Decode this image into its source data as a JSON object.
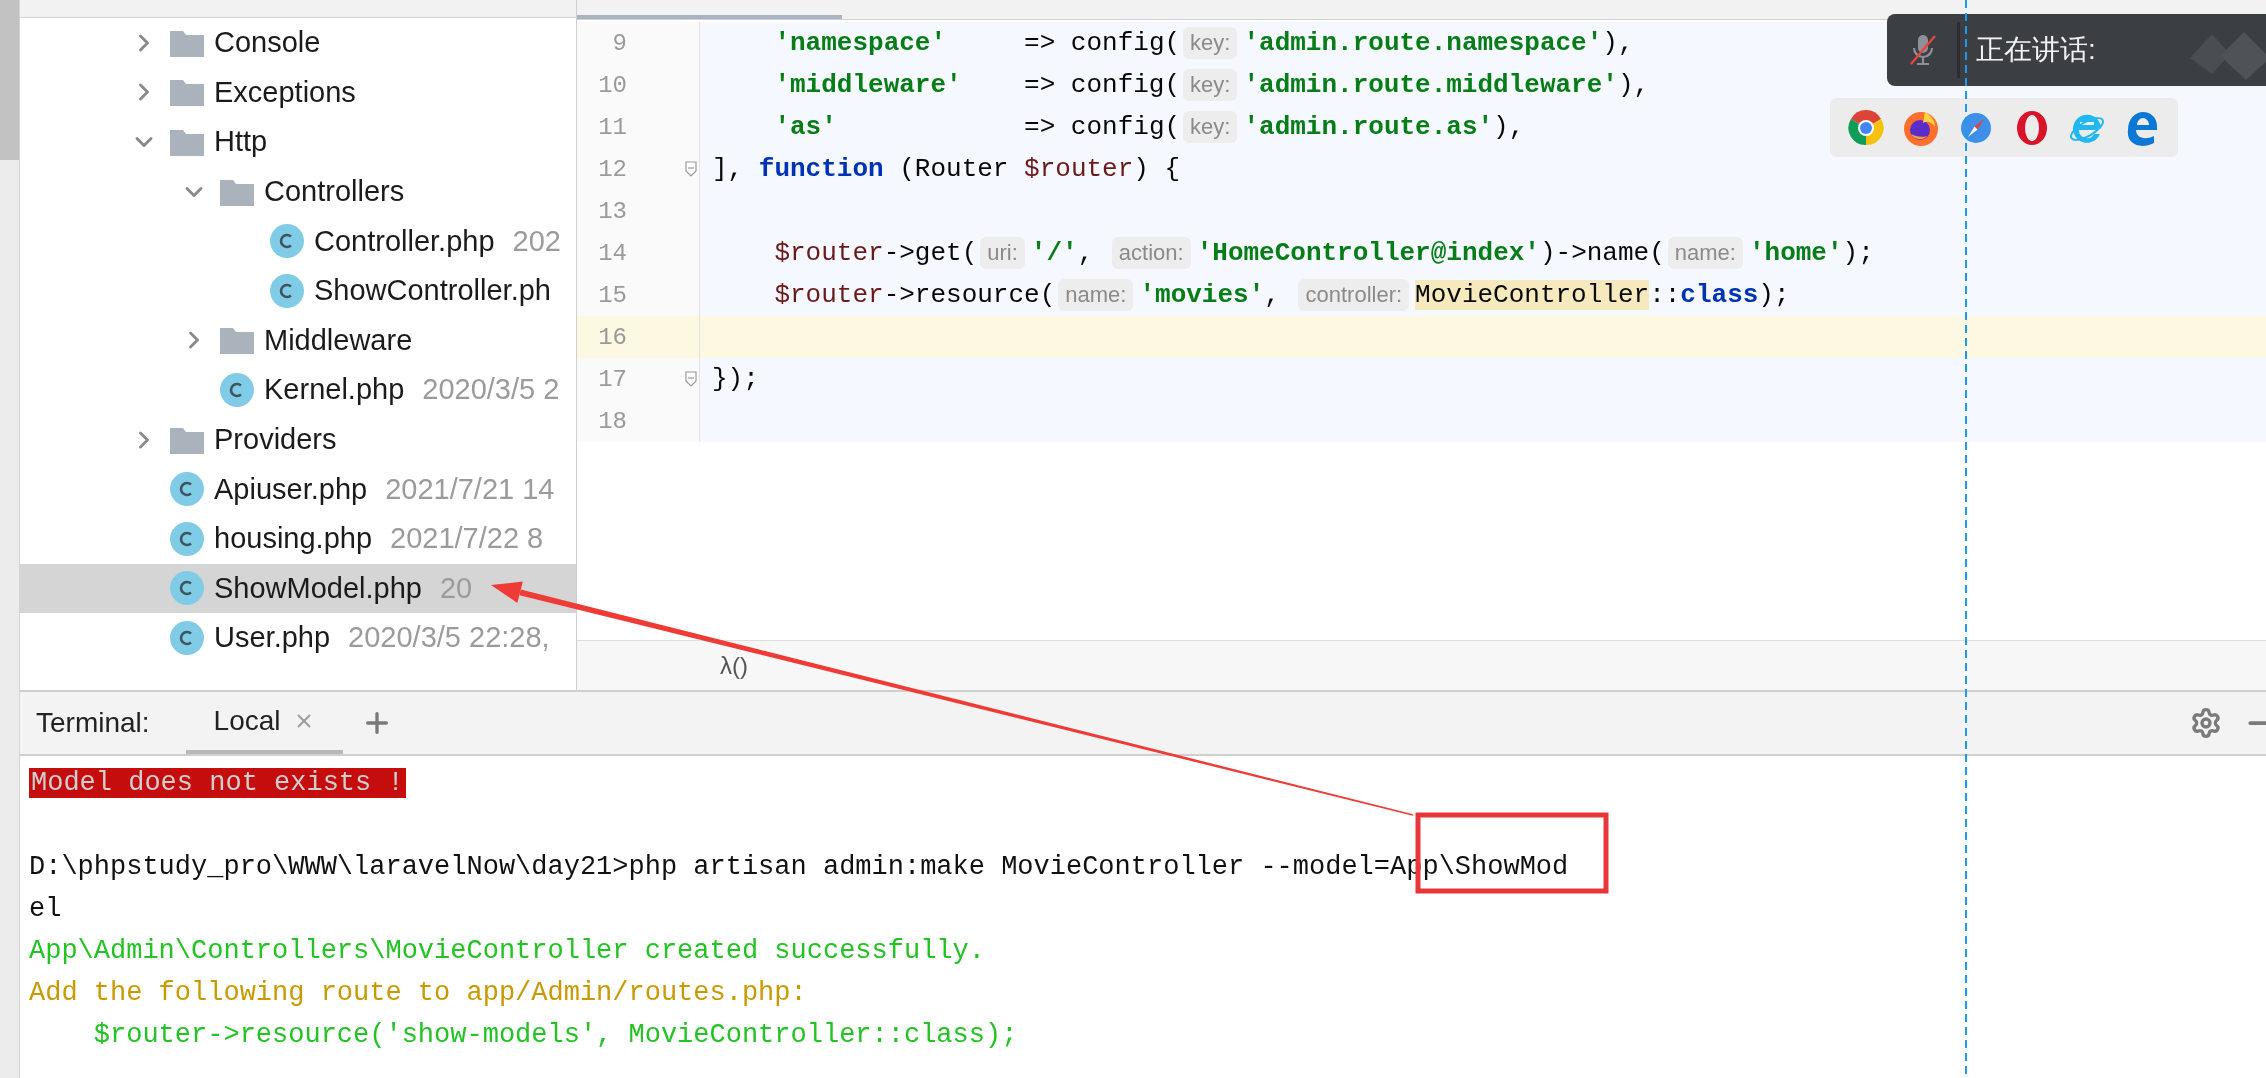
{
  "project_tree": {
    "items": [
      {
        "name": "Console",
        "kind": "folder",
        "expanded": false,
        "selected": false
      },
      {
        "name": "Exceptions",
        "kind": "folder",
        "expanded": false,
        "selected": false
      },
      {
        "name": "Http",
        "kind": "folder",
        "expanded": true,
        "selected": false,
        "children": [
          {
            "name": "Controllers",
            "kind": "folder",
            "expanded": true,
            "selected": false,
            "children": [
              {
                "name": "Controller.php",
                "kind": "class",
                "meta": "202",
                "selected": false
              },
              {
                "name": "ShowController.ph",
                "kind": "class",
                "selected": false
              }
            ]
          },
          {
            "name": "Middleware",
            "kind": "folder",
            "expanded": false,
            "selected": false
          },
          {
            "name": "Kernel.php",
            "kind": "class",
            "meta": "2020/3/5 2",
            "selected": false
          }
        ]
      },
      {
        "name": "Providers",
        "kind": "folder",
        "expanded": false,
        "selected": false
      },
      {
        "name": "Apiuser.php",
        "kind": "class",
        "meta": "2021/7/21 14",
        "selected": false
      },
      {
        "name": "housing.php",
        "kind": "class",
        "meta": "2021/7/22 8",
        "selected": false
      },
      {
        "name": "ShowModel.php",
        "kind": "class",
        "meta": "20",
        "selected": true
      },
      {
        "name": "User.php",
        "kind": "class",
        "meta": "2020/3/5 22:28,",
        "selected": false
      }
    ]
  },
  "editor": {
    "lines": [
      {
        "number": "9",
        "current": false,
        "fold_marker": false,
        "tokens": [
          {
            "kind": "string",
            "text": "    'namespace'"
          },
          {
            "kind": "plain",
            "text": "     => config("
          },
          {
            "kind": "hint",
            "text": "key:"
          },
          {
            "kind": "string",
            "text": "'admin.route.namespace'"
          },
          {
            "kind": "plain",
            "text": "),"
          }
        ]
      },
      {
        "number": "10",
        "current": false,
        "fold_marker": false,
        "tokens": [
          {
            "kind": "string",
            "text": "    'middleware'"
          },
          {
            "kind": "plain",
            "text": "    => config("
          },
          {
            "kind": "hint",
            "text": "key:"
          },
          {
            "kind": "string",
            "text": "'admin.route.middleware'"
          },
          {
            "kind": "plain",
            "text": "),"
          }
        ]
      },
      {
        "number": "11",
        "current": false,
        "fold_marker": false,
        "tokens": [
          {
            "kind": "string",
            "text": "    'as'"
          },
          {
            "kind": "plain",
            "text": "            => config("
          },
          {
            "kind": "hint",
            "text": "key:"
          },
          {
            "kind": "string",
            "text": "'admin.route.as'"
          },
          {
            "kind": "plain",
            "text": "),"
          }
        ]
      },
      {
        "number": "12",
        "current": false,
        "fold_marker": true,
        "tokens": [
          {
            "kind": "plain",
            "text": "], "
          },
          {
            "kind": "keyword",
            "text": "function"
          },
          {
            "kind": "plain",
            "text": " (Router "
          },
          {
            "kind": "variable",
            "text": "$router"
          },
          {
            "kind": "plain",
            "text": ") {"
          }
        ]
      },
      {
        "number": "13",
        "current": false,
        "fold_marker": false
      },
      {
        "number": "14",
        "current": false,
        "fold_marker": false,
        "tokens": [
          {
            "kind": "variable",
            "text": "    $router"
          },
          {
            "kind": "plain",
            "text": "->get("
          },
          {
            "kind": "hint",
            "text": "uri:"
          },
          {
            "kind": "string",
            "text": "'/'"
          },
          {
            "kind": "plain",
            "text": ", "
          },
          {
            "kind": "hint",
            "text": "action:"
          },
          {
            "kind": "string",
            "text": "'HomeController@index'"
          },
          {
            "kind": "plain",
            "text": ")->name("
          },
          {
            "kind": "hint",
            "text": "name:"
          },
          {
            "kind": "string",
            "text": "'home'"
          },
          {
            "kind": "plain",
            "text": ");"
          }
        ]
      },
      {
        "number": "15",
        "current": false,
        "fold_marker": false,
        "tokens": [
          {
            "kind": "variable",
            "text": "    $router"
          },
          {
            "kind": "plain",
            "text": "->resource("
          },
          {
            "kind": "hint",
            "text": "name:"
          },
          {
            "kind": "string",
            "text": "'movies'"
          },
          {
            "kind": "plain",
            "text": ", "
          },
          {
            "kind": "hint",
            "text": "controller:"
          },
          {
            "kind": "reference",
            "text": "MovieController"
          },
          {
            "kind": "plain",
            "text": "::"
          },
          {
            "kind": "keyword",
            "text": "class"
          },
          {
            "kind": "plain",
            "text": ");"
          }
        ]
      },
      {
        "number": "16",
        "current": true,
        "fold_marker": false
      },
      {
        "number": "17",
        "current": false,
        "fold_marker": true,
        "tokens": [
          {
            "kind": "plain",
            "text": "});"
          }
        ]
      },
      {
        "number": "18",
        "current": false,
        "fold_marker": false
      }
    ],
    "breadcrumb": "λ()"
  },
  "terminal": {
    "title": "Terminal:",
    "tabs": [
      {
        "label": "Local",
        "selected": true
      }
    ],
    "lines": [
      {
        "kind": "error",
        "text": "Model does not exists !"
      },
      {
        "kind": "blank"
      },
      {
        "kind": "normal",
        "text": "D:\\phpstudy_pro\\WWW\\laravelNow\\day21>php artisan admin:make MovieController --model=App\\ShowMod"
      },
      {
        "kind": "normal",
        "text": "el"
      },
      {
        "kind": "success",
        "text": "App\\Admin\\Controllers\\MovieController created successfully."
      },
      {
        "kind": "warning",
        "text": "Add the following route to app/Admin/routes.php:"
      },
      {
        "kind": "success",
        "text": "    $router->resource('show-models', MovieController::class);"
      }
    ]
  },
  "call_overlay": {
    "label": "正在讲话:",
    "muted": true
  },
  "browser_bar": {
    "items": [
      {
        "kind": "tricolor"
      },
      {
        "kind": "fox"
      },
      {
        "kind": "compass"
      },
      {
        "kind": "ring"
      },
      {
        "kind": "orbit"
      },
      {
        "kind": "wave"
      }
    ]
  },
  "annotations": [
    {
      "kind": "box"
    },
    {
      "kind": "arrow"
    },
    {
      "kind": "guide"
    }
  ]
}
